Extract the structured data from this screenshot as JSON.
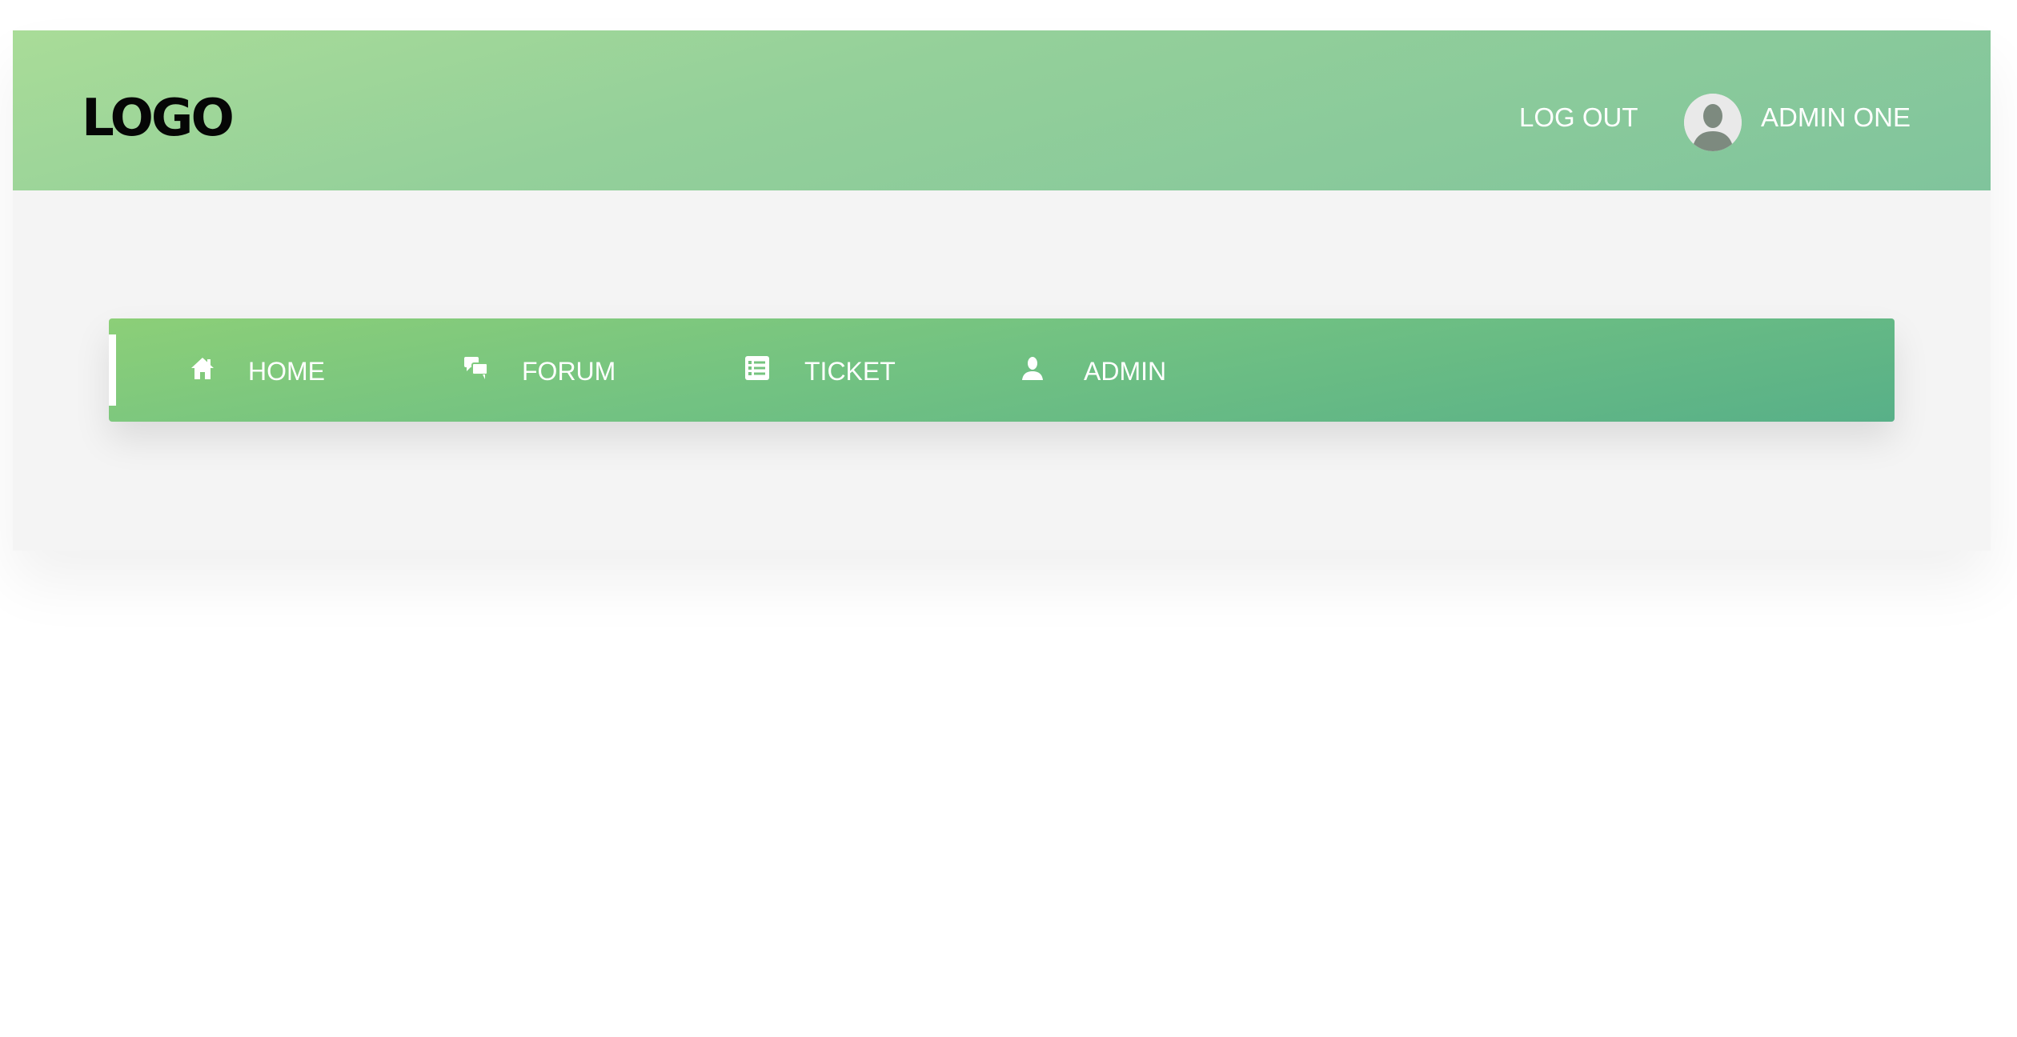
{
  "header": {
    "logo_text": "LOGO",
    "logout_label": "LOG OUT",
    "username": "ADMIN ONE",
    "avatar_icon": "user-silhouette-icon"
  },
  "nav": {
    "items": [
      {
        "label": "HOME",
        "icon": "home-icon",
        "active": true
      },
      {
        "label": "FORUM",
        "icon": "chat-bubbles-icon",
        "active": false
      },
      {
        "label": "TICKET",
        "icon": "list-icon",
        "active": false
      },
      {
        "label": "ADMIN",
        "icon": "user-icon",
        "active": false
      }
    ]
  },
  "colors": {
    "header_gradient_start": "#a9dc98",
    "header_gradient_end": "#80c49c",
    "nav_gradient_start": "#8ccf78",
    "nav_gradient_end": "#58b088",
    "page_background": "#f4f4f4",
    "text_light": "#ffffff",
    "logo_color": "#060606"
  }
}
